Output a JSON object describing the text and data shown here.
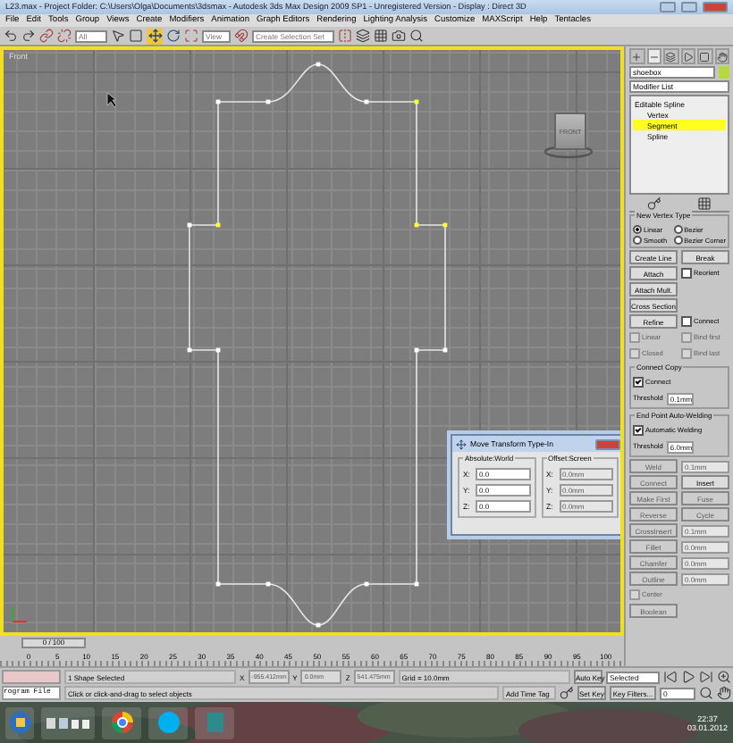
{
  "window": {
    "title": "L23.max  -  Project Folder: C:\\Users\\Olga\\Documents\\3dsmax  -  Autodesk 3ds Max Design 2009 SP1  -  Unregistered Version  -  Display : Direct 3D"
  },
  "menu": [
    "File",
    "Edit",
    "Tools",
    "Group",
    "Views",
    "Create",
    "Modifiers",
    "Animation",
    "Graph Editors",
    "Rendering",
    "Lighting Analysis",
    "Customize",
    "MAXScript",
    "Help",
    "Tentacles"
  ],
  "toolbar": {
    "filter": "All",
    "reference": "View",
    "selection_set": "Create Selection Set"
  },
  "viewport": {
    "label": "Front",
    "viewcube": "FRONT"
  },
  "dialog": {
    "title": "Move Transform Type-In",
    "groups": [
      {
        "title": "Absolute:World",
        "fields": [
          {
            "axis": "X:",
            "value": "0.0"
          },
          {
            "axis": "Y:",
            "value": "0.0"
          },
          {
            "axis": "Z:",
            "value": "0.0"
          }
        ]
      },
      {
        "title": "Offset:Screen",
        "fields": [
          {
            "axis": "X:",
            "value": "0.0mm"
          },
          {
            "axis": "Y:",
            "value": "0.0mm"
          },
          {
            "axis": "Z:",
            "value": "0.0mm"
          }
        ]
      }
    ]
  },
  "command_panel": {
    "tabs": [
      {
        "kind": "create",
        "selected": false
      },
      {
        "kind": "modify",
        "selected": true
      },
      {
        "kind": "hierarchy",
        "selected": false
      },
      {
        "kind": "motion",
        "selected": false
      },
      {
        "kind": "display",
        "selected": false
      },
      {
        "kind": "utilities",
        "selected": false
      }
    ],
    "object_name": "shoebox",
    "modifier_list": "Modifier List",
    "stack": {
      "label": "Editable Spline",
      "children": [
        {
          "label": "Vertex",
          "selected": false
        },
        {
          "label": "Segment",
          "selected": true
        },
        {
          "label": "Spline",
          "selected": false
        }
      ]
    },
    "new_vertex_type": {
      "title": "New Vertex Type",
      "options": [
        {
          "label": "Linear",
          "selected": true
        },
        {
          "label": "Bezier",
          "selected": false
        },
        {
          "label": "Smooth",
          "selected": false
        },
        {
          "label": "Bezier Corner",
          "selected": false
        }
      ]
    },
    "sections": [
      {
        "rows": [
          [
            {
              "kind": "button",
              "label": "Create Line",
              "disabled": false
            },
            {
              "kind": "button",
              "label": "Break",
              "disabled": false
            }
          ],
          [
            {
              "kind": "button",
              "label": "Attach",
              "disabled": false
            },
            {
              "kind": "checkbox",
              "label": "Reorient",
              "checked": false,
              "disabled": false
            }
          ],
          [
            {
              "kind": "button",
              "label": "Attach Mult.",
              "disabled": false
            }
          ],
          [
            {
              "kind": "button",
              "label": "Cross Section",
              "disabled": false
            }
          ],
          [
            {
              "kind": "button",
              "label": "Refine",
              "disabled": false
            },
            {
              "kind": "checkbox",
              "label": "Connect",
              "checked": false,
              "disabled": false
            }
          ],
          [
            {
              "kind": "checkbox",
              "label": "Linear",
              "checked": false,
              "disabled": true
            },
            {
              "kind": "checkbox",
              "label": "Bind first",
              "checked": false,
              "disabled": true
            }
          ],
          [
            {
              "kind": "checkbox",
              "label": "Closed",
              "checked": false,
              "disabled": true
            },
            {
              "kind": "checkbox",
              "label": "Bind last",
              "checked": false,
              "disabled": true
            }
          ]
        ]
      },
      {
        "title": "Connect Copy",
        "rows": [
          [
            {
              "kind": "checkbox",
              "label": "Connect",
              "checked": true,
              "disabled": false
            }
          ],
          [
            {
              "kind": "spinner",
              "label": "Threshold",
              "value": "0.1mm",
              "disabled": false
            }
          ]
        ]
      },
      {
        "title": "End Point Auto-Welding",
        "rows": [
          [
            {
              "kind": "checkbox",
              "label": "Automatic Welding",
              "checked": true,
              "disabled": false
            }
          ],
          [
            {
              "kind": "spinner",
              "label": "Threshold",
              "value": "6.0mm",
              "disabled": false
            }
          ]
        ]
      },
      {
        "rows": [
          [
            {
              "kind": "button",
              "label": "Weld",
              "disabled": true
            },
            {
              "kind": "spinner",
              "value": "0.1mm",
              "disabled": true
            }
          ],
          [
            {
              "kind": "button",
              "label": "Connect",
              "disabled": true
            },
            {
              "kind": "button",
              "label": "Insert",
              "disabled": false
            }
          ],
          [
            {
              "kind": "button",
              "label": "Make First",
              "disabled": true
            },
            {
              "kind": "button",
              "label": "Fuse",
              "disabled": true
            }
          ],
          [
            {
              "kind": "button",
              "label": "Reverse",
              "disabled": true
            },
            {
              "kind": "button",
              "label": "Cycle",
              "disabled": true
            }
          ],
          [
            {
              "kind": "button",
              "label": "CrossInsert",
              "disabled": true
            },
            {
              "kind": "spinner",
              "value": "0.1mm",
              "disabled": true
            }
          ],
          [
            {
              "kind": "button",
              "label": "Fillet",
              "disabled": true
            },
            {
              "kind": "spinner",
              "value": "0.0mm",
              "disabled": true
            }
          ],
          [
            {
              "kind": "button",
              "label": "Chamfer",
              "disabled": true
            },
            {
              "kind": "spinner",
              "value": "0.0mm",
              "disabled": true
            }
          ],
          [
            {
              "kind": "button",
              "label": "Outline",
              "disabled": true
            },
            {
              "kind": "spinner",
              "value": "0.0mm",
              "disabled": true
            }
          ],
          [
            {
              "kind": "checkbox",
              "label": "Center",
              "checked": false,
              "disabled": true
            }
          ],
          [
            {
              "kind": "button",
              "label": "Boolean",
              "disabled": true
            }
          ]
        ]
      }
    ]
  },
  "timeline": {
    "slider": "0 / 100",
    "level": 0,
    "ticks": [
      "0",
      "5",
      "10",
      "15",
      "20",
      "25",
      "30",
      "35",
      "40",
      "45",
      "50",
      "55",
      "60",
      "65",
      "70",
      "75",
      "80",
      "85",
      "90",
      "95",
      "100"
    ]
  },
  "status_bar": {
    "listener": "rogram File",
    "selection": "1 Shape Selected",
    "coords": [
      {
        "axis": "X",
        "value": "-955.412mm"
      },
      {
        "axis": "Y",
        "value": "0.0mm"
      },
      {
        "axis": "Z",
        "value": "541.475mm"
      }
    ],
    "grid": "Grid = 10.0mm",
    "prompt": "Click or click-and-drag to select objects",
    "time_tag": "Add Time Tag",
    "auto_key": "Auto Key",
    "key_mode": "Selected",
    "set_key": "Set Key",
    "key_filters": "Key Filters...",
    "frame": "0"
  },
  "taskbar": {
    "time": "22:37",
    "date": "03.01.2012"
  }
}
